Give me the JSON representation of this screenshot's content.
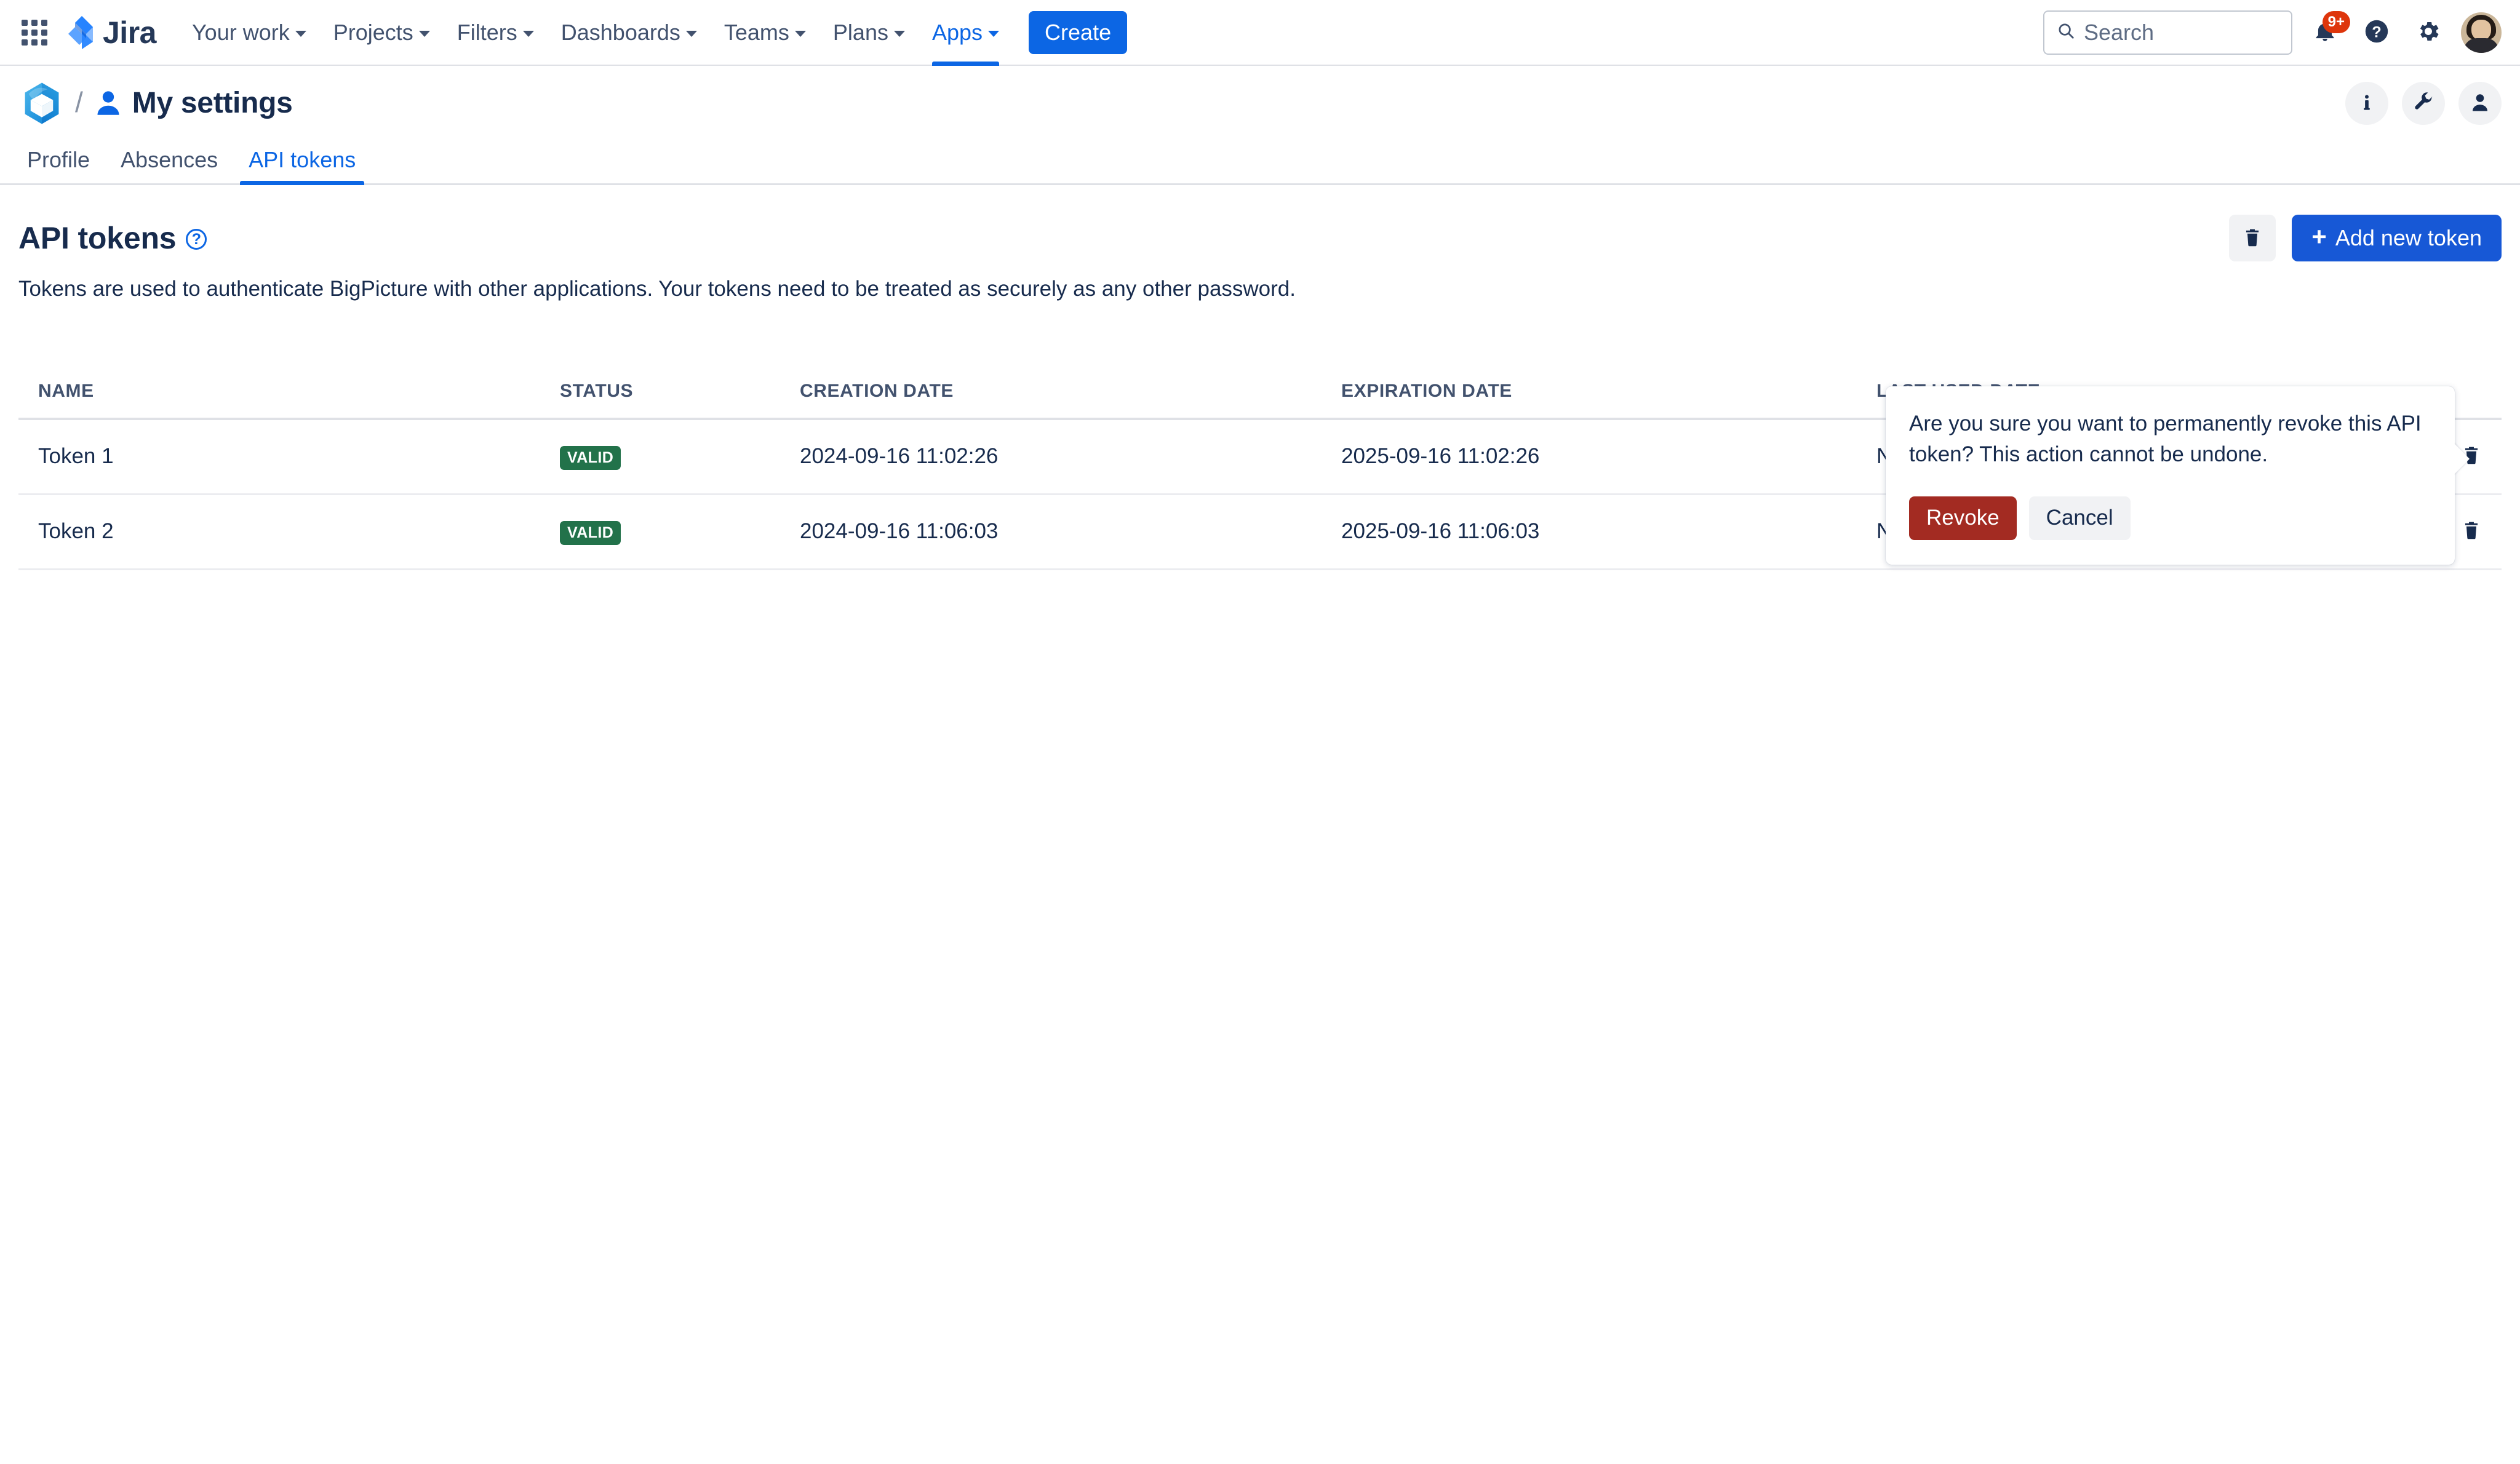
{
  "jira_nav": {
    "app_switcher_icon": "grid-apps-icon",
    "logo_text": "Jira",
    "items": [
      {
        "label": "Your work",
        "has_caret": true,
        "active": false
      },
      {
        "label": "Projects",
        "has_caret": true,
        "active": false
      },
      {
        "label": "Filters",
        "has_caret": true,
        "active": false
      },
      {
        "label": "Dashboards",
        "has_caret": true,
        "active": false
      },
      {
        "label": "Teams",
        "has_caret": true,
        "active": false
      },
      {
        "label": "Plans",
        "has_caret": true,
        "active": false
      },
      {
        "label": "Apps",
        "has_caret": true,
        "active": true
      }
    ],
    "create_label": "Create",
    "search": {
      "placeholder": "Search",
      "value": "",
      "icon": "search-icon"
    },
    "notifications": {
      "icon": "notification-bell-icon",
      "badge": "9+",
      "badge_color": "#de350b"
    },
    "help_icon": "help-question-icon",
    "settings_icon": "gear-icon",
    "avatar_icon": "user-avatar"
  },
  "bigpicture_header": {
    "logo_icon": "bigpicture-logo",
    "separator": "/",
    "person_icon": "person-icon",
    "title": "My settings",
    "actions": [
      {
        "icon": "info-icon",
        "name": "info-button"
      },
      {
        "icon": "wrench-icon",
        "name": "tools-button"
      },
      {
        "icon": "person-icon",
        "name": "user-button"
      }
    ]
  },
  "tabs": [
    {
      "label": "Profile",
      "active": false
    },
    {
      "label": "Absences",
      "active": false
    },
    {
      "label": "API tokens",
      "active": true
    }
  ],
  "section": {
    "title": "API tokens",
    "help_icon": "question-mark-icon",
    "help_glyph": "?",
    "description": "Tokens are used to authenticate BigPicture with other applications. Your tokens need to be treated as securely as any other password.",
    "bulk_delete_icon": "trash-icon",
    "add_button_label": "Add new token",
    "add_button_plus": "+",
    "accent_color": "#1758d6"
  },
  "table": {
    "columns": [
      "NAME",
      "STATUS",
      "CREATION DATE",
      "EXPIRATION DATE",
      "LAST USED DATE",
      ""
    ],
    "rows": [
      {
        "name": "Token 1",
        "status": "VALID",
        "creation_date": "2024-09-16 11:02:26",
        "expiration_date": "2025-09-16 11:02:26",
        "last_used_date": "Never",
        "delete_icon": "trash-icon"
      },
      {
        "name": "Token 2",
        "status": "VALID",
        "creation_date": "2024-09-16 11:06:03",
        "expiration_date": "2025-09-16 11:06:03",
        "last_used_date": "Never",
        "delete_icon": "trash-icon"
      }
    ],
    "status_color": "#22724a"
  },
  "confirm_popover": {
    "message": "Are you sure you want to permanently revoke this API token? This action cannot be undone.",
    "revoke_label": "Revoke",
    "cancel_label": "Cancel",
    "revoke_color": "#a32b22"
  }
}
